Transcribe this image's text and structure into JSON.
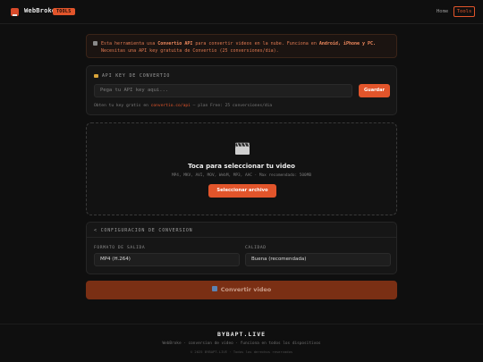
{
  "header": {
    "brand": "WebBroke",
    "badge": "TOOLS",
    "nav_home": "Home",
    "nav_tools": "Tools"
  },
  "notice": {
    "prefix": "Esta herramienta usa ",
    "api": "Convertio API",
    "mid": " para convertir videos en la nube. Funciona en ",
    "platforms": "Android, iPhone y PC.",
    "line2": "Necesitas una API key gratuita de Convertio (25 conversiones/dia)."
  },
  "api": {
    "title": "API KEY DE CONVERTIO",
    "placeholder": "Pega tu API key aqui...",
    "button": "Guardar",
    "hint_prefix": "Obten tu key gratis en ",
    "hint_link": "convertio.co/api",
    "hint_suffix": " — plan Free: 25 conversiones/dia"
  },
  "upload": {
    "title": "Toca para seleccionar tu video",
    "formats": "MP4, MKV, AVI, MOV, WebM, MP3, AAC · Max recomendado: 500MB",
    "button": "Seleccionar archivo"
  },
  "config": {
    "title": "< CONFIGURACION DE CONVERSION",
    "format_label": "FORMATO DE SALIDA",
    "format_value": "MP4 (H.264)",
    "quality_label": "CALIDAD",
    "quality_value": "Buena (recomendada)"
  },
  "convert": {
    "label": "Convertir video"
  },
  "footer": {
    "brand": "BYBAPT.LIVE",
    "sub": "WebBroke · conversion de video · funciona en todos los dispositivos",
    "copy": "© 2025 BYBAPT.LIVE · Todos los derechos reservados"
  },
  "colors": {
    "accent": "#e2552b",
    "background": "#0f0f0f",
    "card": "#161616"
  }
}
